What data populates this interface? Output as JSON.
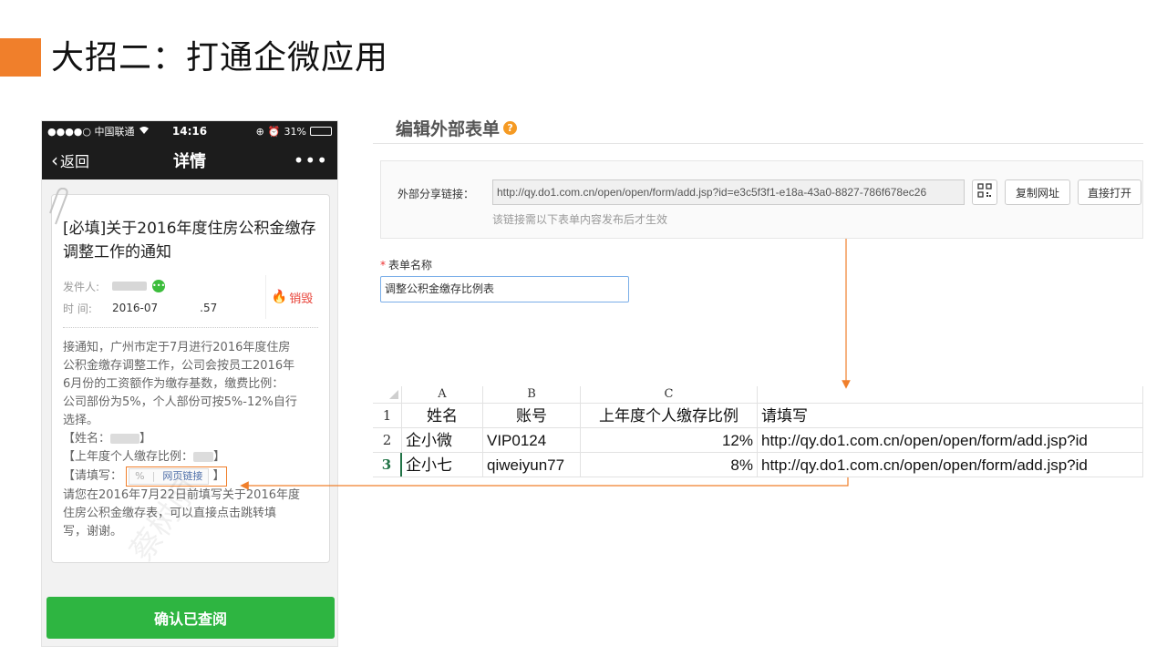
{
  "slide": {
    "title": "大招二：打通企微应用"
  },
  "phone": {
    "status": {
      "carrier": "●●●●○ 中国联通",
      "time": "14:16",
      "battery": "31%",
      "battery_level": 0.31
    },
    "nav": {
      "back_label": "返回",
      "title": "详情",
      "more": "•••"
    },
    "message": {
      "title": "[必填]关于2016年度住房公积金缴存调整工作的通知",
      "sender_label": "发件人:",
      "time_label": "时  间:",
      "time_prefix": "2016-07",
      "time_suffix": ".57",
      "destroy_label": "销毁",
      "body_lines": [
        "接通知，广州市定于7月进行2016年度住房",
        "公积金缴存调整工作，公司会按员工2016年",
        "6月份的工资额作为缴存基数，缴费比例：",
        "公司部份为5%，个人部份可按5%-12%自行",
        "选择。"
      ],
      "field_name_prefix": "【姓名：",
      "field_name_suffix": "】",
      "field_ratio_prefix": "【上年度个人缴存比例：",
      "field_ratio_suffix": "】",
      "field_fill_prefix": "【请填写：",
      "field_fill_link": "网页链接",
      "field_fill_suffix": "】",
      "closing_lines": [
        "请您在2016年7月22日前填写关于2016年度",
        "住房公积金缴存表，可以直接点击跳转填",
        "写，谢谢。"
      ],
      "watermark": "蔡树丽"
    },
    "confirm_label": "确认已查阅"
  },
  "form": {
    "heading": "编辑外部表单",
    "help": "?",
    "share_label": "外部分享链接：",
    "share_url": "http://qy.do1.com.cn/open/open/form/add.jsp?id=e3c5f3f1-e18a-43a0-8827-786f678ec26",
    "copy_label": "复制网址",
    "open_label": "直接打开",
    "share_hint": "该链接需以下表单内容发布后才生效",
    "name_label": "表单名称",
    "name_required": "*",
    "name_value": "调整公积金缴存比例表"
  },
  "sheet": {
    "columns": [
      "A",
      "B",
      "C"
    ],
    "rows": [
      {
        "num": "1",
        "a": "姓名",
        "b": "账号",
        "c": "上年度个人缴存比例",
        "d": "请填写"
      },
      {
        "num": "2",
        "a": "企小微",
        "b": "VIP0124",
        "c": "12%",
        "d": "http://qy.do1.com.cn/open/open/form/add.jsp?id"
      },
      {
        "num": "3",
        "a": "企小七",
        "b": "qiweiyun77",
        "c": "8%",
        "d": "http://qy.do1.com.cn/open/open/form/add.jsp?id"
      }
    ]
  },
  "colors": {
    "accent": "#f07f2b",
    "confirm": "#2eb541",
    "destroy": "#e8443a"
  }
}
